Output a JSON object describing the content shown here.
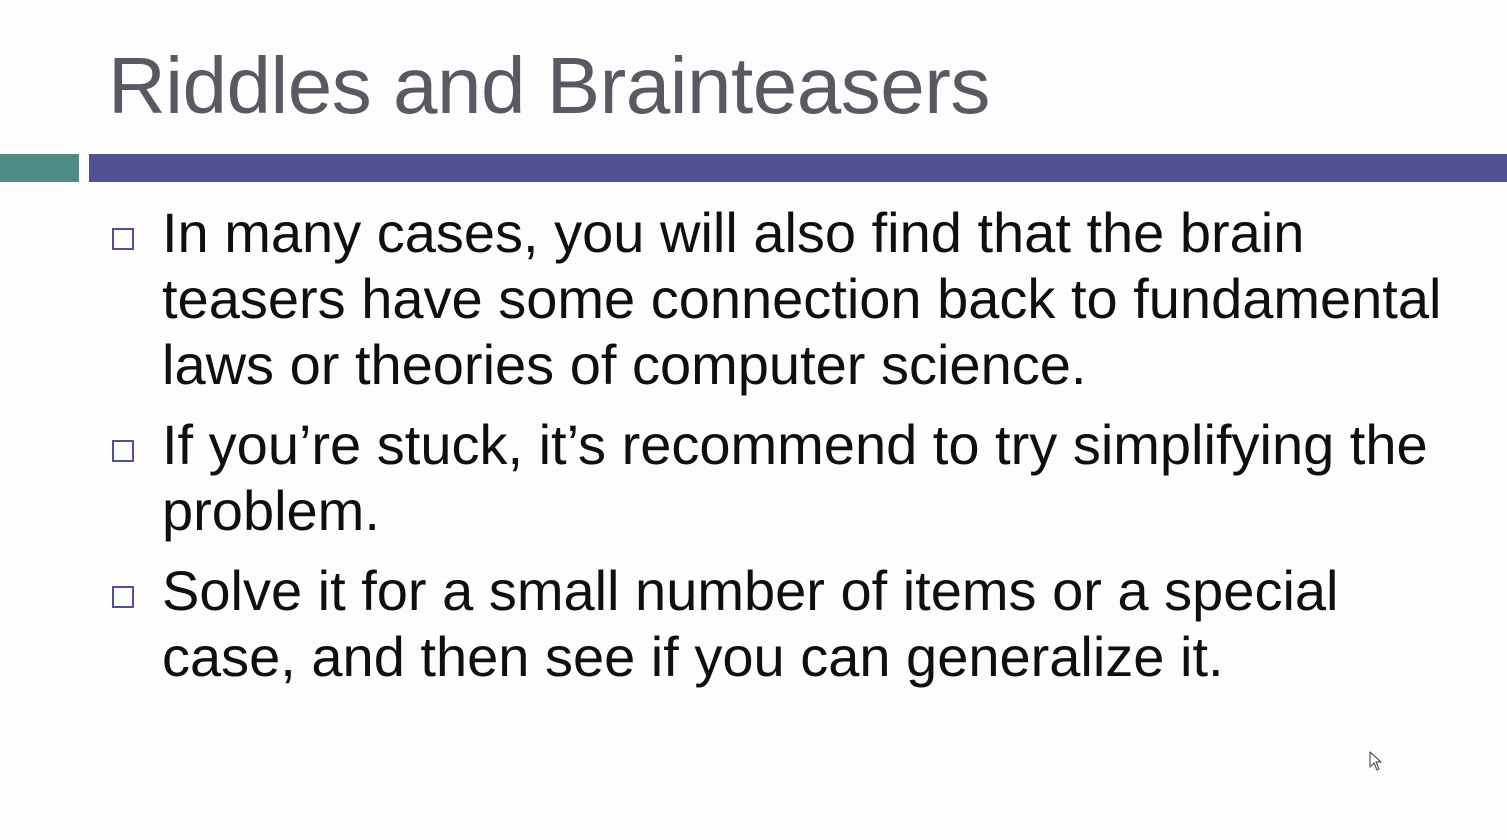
{
  "slide": {
    "title": "Riddles and Brainteasers",
    "bullets": [
      "In many cases, you will also find that the brain teasers have some connection back to fundamental laws or theories of computer science.",
      "If you’re stuck, it’s recommend to try simplifying the problem.",
      "Solve it for a small number of items or a special case, and then see if you can generalize it."
    ],
    "bullet_icon": "hollow-square-bullet",
    "colors": {
      "title": "#595963",
      "text": "#0f0f0f",
      "accent_teal": "#4e8c86",
      "accent_purple": "#4f5191"
    }
  },
  "cursor": {
    "icon": "mouse-pointer-icon"
  }
}
